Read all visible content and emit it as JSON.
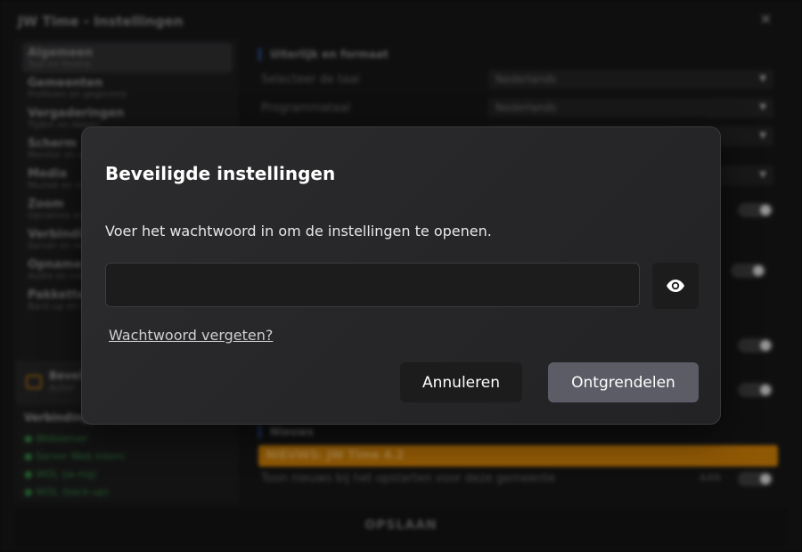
{
  "background": {
    "window_title": "JW Time - Instellingen",
    "close_symbol": "✕",
    "sidebar": [
      {
        "title": "Algemeen",
        "subtitle": "Taal en thema"
      },
      {
        "title": "Gemeenten",
        "subtitle": "Profielen en gegevens"
      },
      {
        "title": "Vergaderingen",
        "subtitle": "Tijden en dagen"
      },
      {
        "title": "Scherm",
        "subtitle": "Monitor en weergave"
      },
      {
        "title": "Media",
        "subtitle": "Muziek en video"
      },
      {
        "title": "Zoom",
        "subtitle": "Opnames en verbinding"
      },
      {
        "title": "Verbinding",
        "subtitle": "Server en netwerk"
      },
      {
        "title": "Opnames",
        "subtitle": "Audio en video"
      },
      {
        "title": "Pakketten",
        "subtitle": "Back-up en herstel"
      }
    ],
    "secure": {
      "title": "Beveiliging",
      "subtitle": "Actief"
    },
    "connections": {
      "title": "Verbindingen",
      "items": [
        "Webserver",
        "Server Web Intern",
        "WOL (ja-nig)",
        "WOL (back-up)"
      ]
    },
    "main": {
      "section_appearance": "Uiterlijk en formaat",
      "language_label": "Selecteer de taal",
      "language_value": "Nederlands",
      "program_language_label": "Programmataal",
      "program_language_value": "Nederlands",
      "section_news": "Nieuws",
      "news_bar": "NIEUWS: JW Time 4.2",
      "news_toggle_label": "Toon nieuws bij het opstarten voor deze gemeente",
      "news_toggle_state": "AAN"
    },
    "footer_button": "OPSLAAN"
  },
  "dialog": {
    "title": "Beveiligde instellingen",
    "message": "Voer het wachtwoord in om de instellingen te openen.",
    "password_value": "",
    "password_placeholder": "",
    "show_password_icon": "eye-icon",
    "forgot_link": "Wachtwoord vergeten?",
    "cancel_button": "Annuleren",
    "unlock_button": "Ontgrendelen"
  },
  "colors": {
    "dialog_bg": "#2a2a2c",
    "unlock_button": "#5c5c66",
    "cancel_button": "#1c1c1d",
    "news_accent": "#c77b07"
  }
}
